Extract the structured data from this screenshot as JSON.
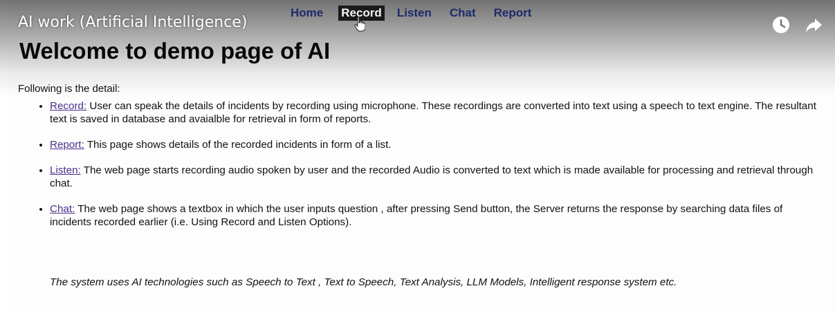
{
  "video": {
    "title": "AI work (Artificial Intelligence)",
    "watch_later_icon": "clock-icon",
    "share_icon": "share-arrow-icon"
  },
  "nav": {
    "items": [
      {
        "label": "Home"
      },
      {
        "label": "Record"
      },
      {
        "label": "Listen"
      },
      {
        "label": "Chat"
      },
      {
        "label": "Report"
      }
    ],
    "active": "Record",
    "color": "#1f2a6b"
  },
  "page": {
    "title": "Welcome to demo page of AI",
    "intro": "Following is the detail:",
    "items": [
      {
        "link": "Record:",
        "text": " User can speak the details of incidents by recording using microphone. These recordings are converted into text using a speech to text engine. The resultant text is saved in database and avaialble for retrieval in form of reports."
      },
      {
        "link": "Report:",
        "text": " This page shows details of the recorded incidents in form of a list."
      },
      {
        "link": "Listen:",
        "text": " The web page starts recording audio spoken by user and the recorded Audio is converted to text which is made available for processing and retrieval through chat."
      },
      {
        "link": "Chat:",
        "text": " The web page shows a textbox in which the user inputs question , after pressing Send button, the Server returns the response by searching data files of incidents recorded earlier (i.e. Using Record and Listen Options)."
      }
    ],
    "summary": "The system uses AI technologies such as Speech to Text , Text to Speech, Text Analysis, LLM Models, Intelligent response system etc."
  }
}
